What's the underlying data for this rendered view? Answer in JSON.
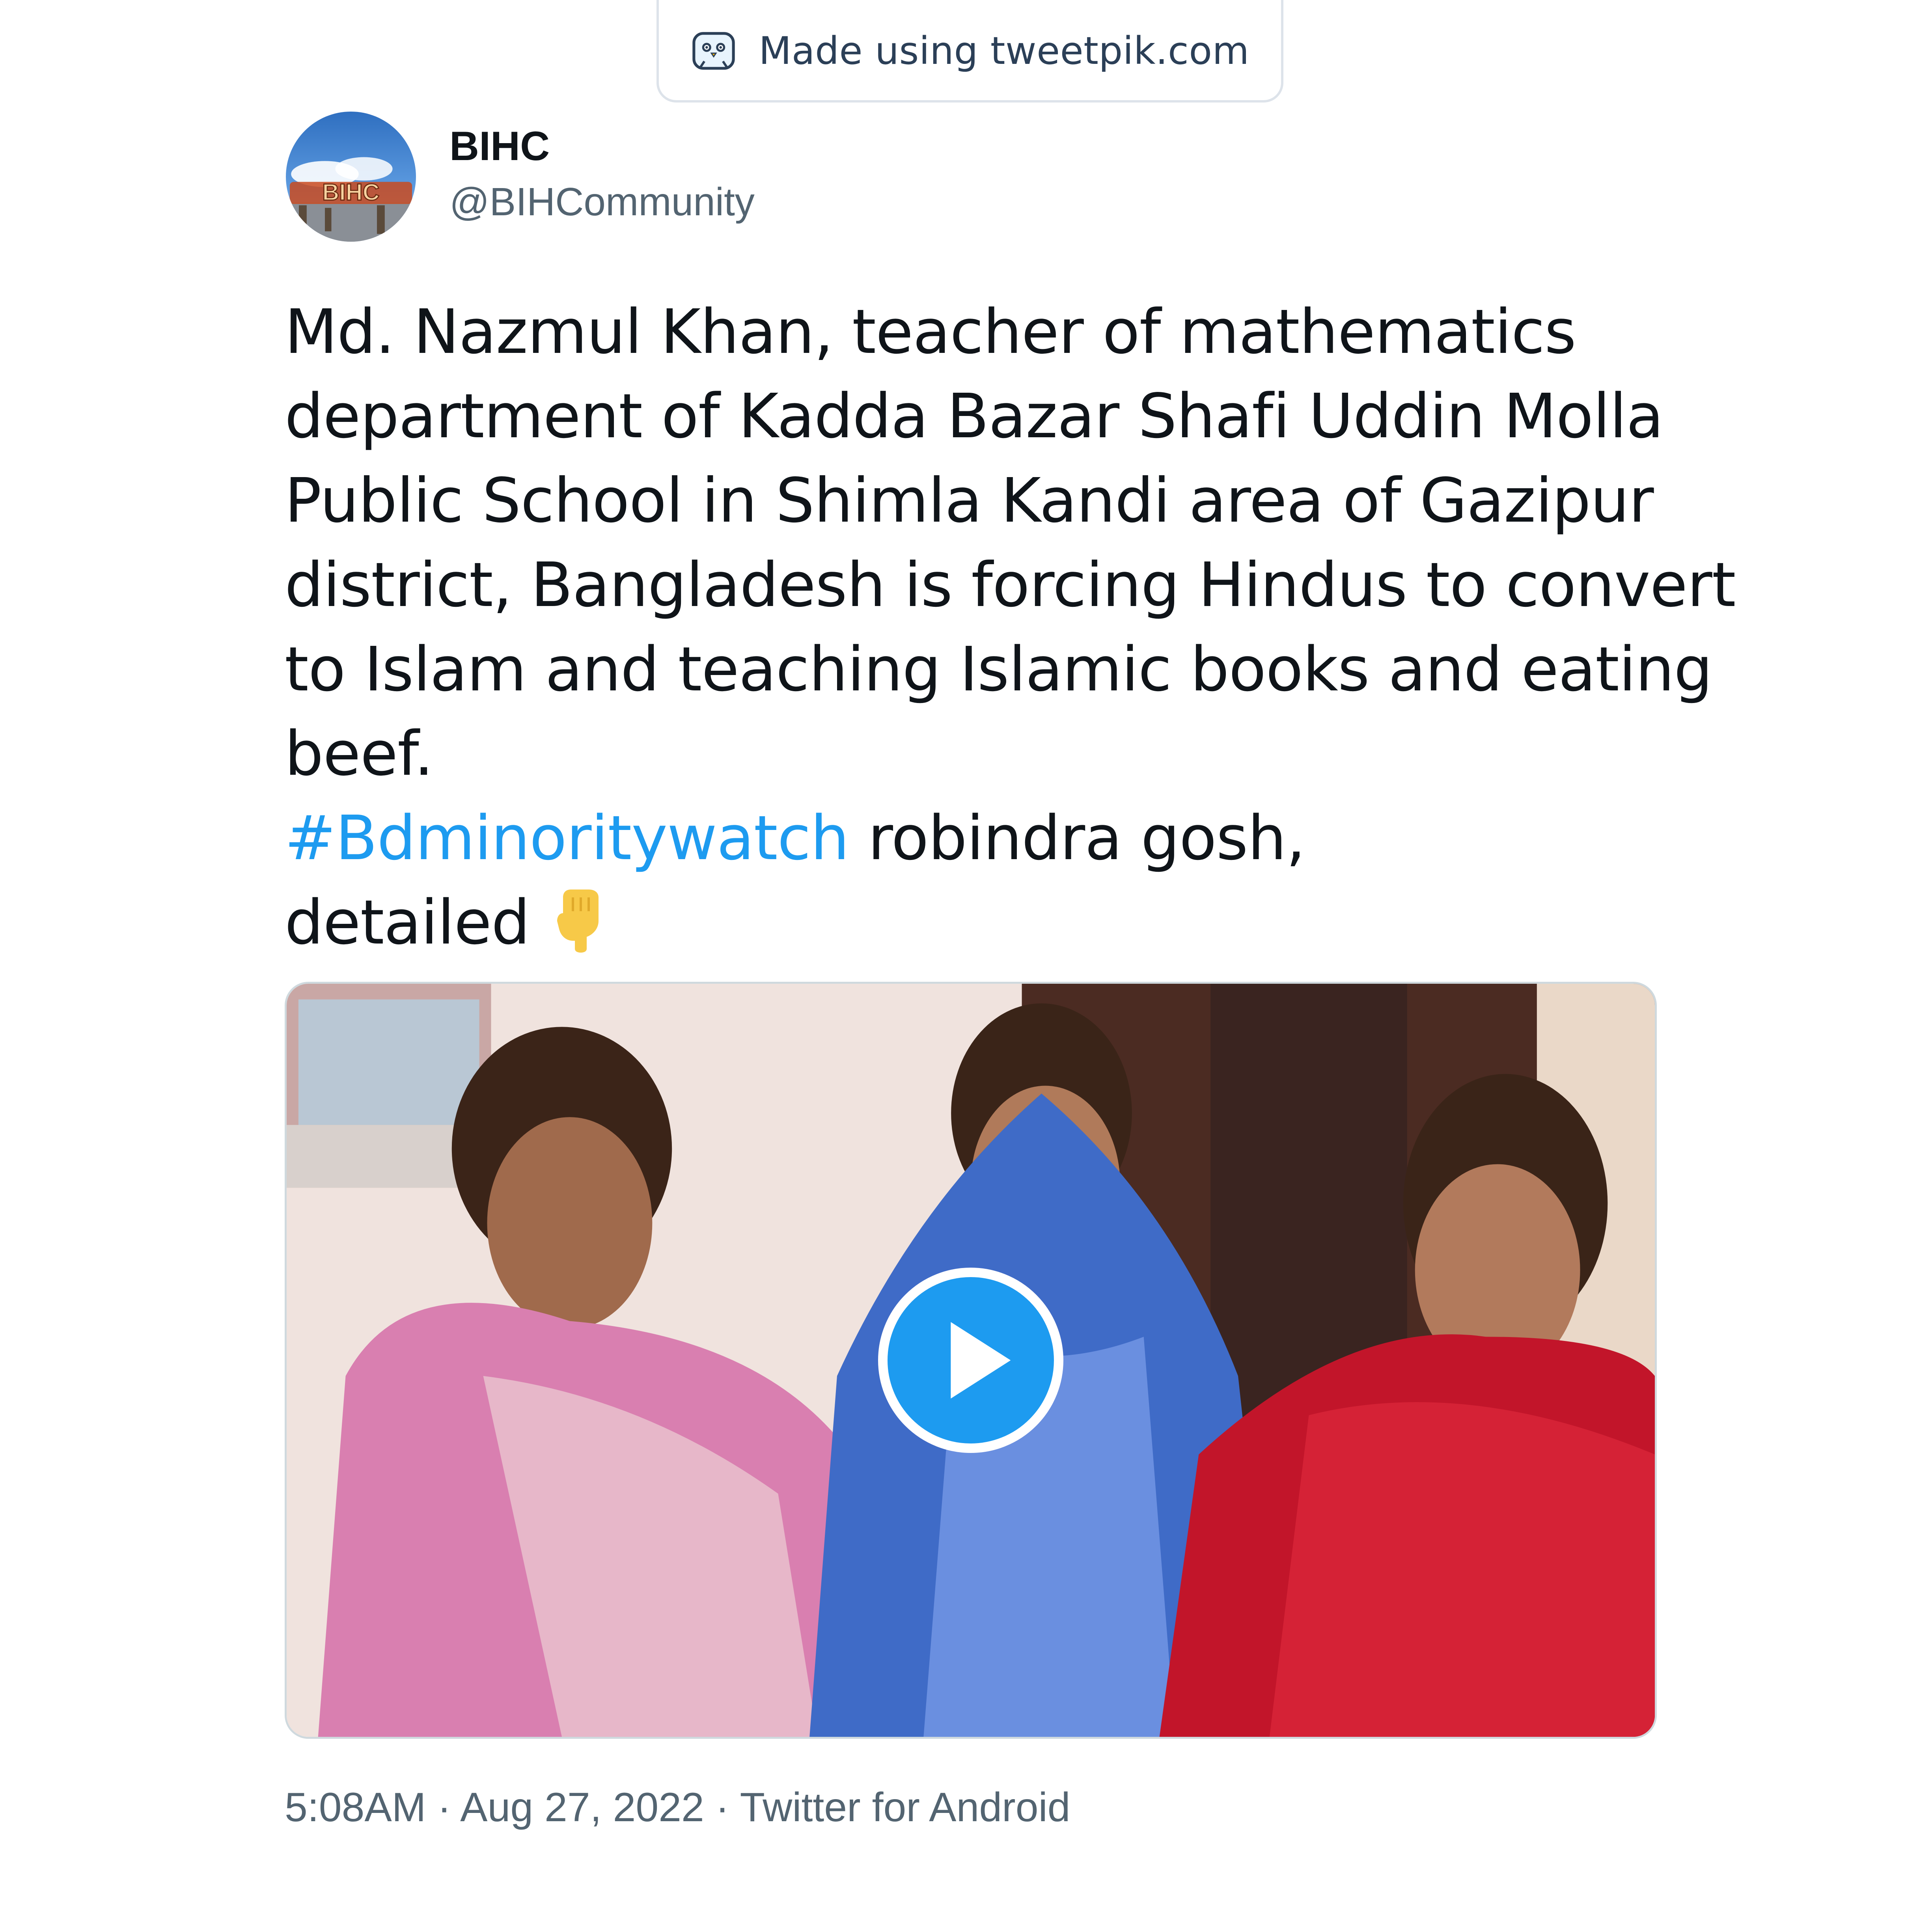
{
  "watermark": {
    "text": "Made using tweetpik.com",
    "icon": "tweetpik-bird-icon"
  },
  "author": {
    "display_name": "BIHC",
    "handle": "@BIHCommunity",
    "avatar_icon": "bihc-logo-avatar",
    "avatar_logo_text": "BIHC"
  },
  "tweet": {
    "lines": [
      "Md. Nazmul Khan, teacher of mathematics",
      "department of Kadda Bazar Shafi Uddin Molla",
      "Public School in Shimla Kandi area of Gazipur",
      "district, Bangladesh is forcing Hindus to convert",
      "to Islam and teaching Islamic books and eating",
      "beef."
    ],
    "hashtag": "#Bdminoritywatch",
    "after_hashtag": " robindra gosh,",
    "last_line": "detailed",
    "emoji": "backhand-index-pointing-down"
  },
  "media": {
    "type": "video",
    "play_icon": "play-icon"
  },
  "meta": {
    "time": "5:08AM",
    "separator": " · ",
    "date": "Aug 27, 2022",
    "source": "Twitter for Android"
  },
  "colors": {
    "text": "#0f1419",
    "secondary": "#536471",
    "link": "#1d9bf0",
    "border": "#cfd9de"
  }
}
